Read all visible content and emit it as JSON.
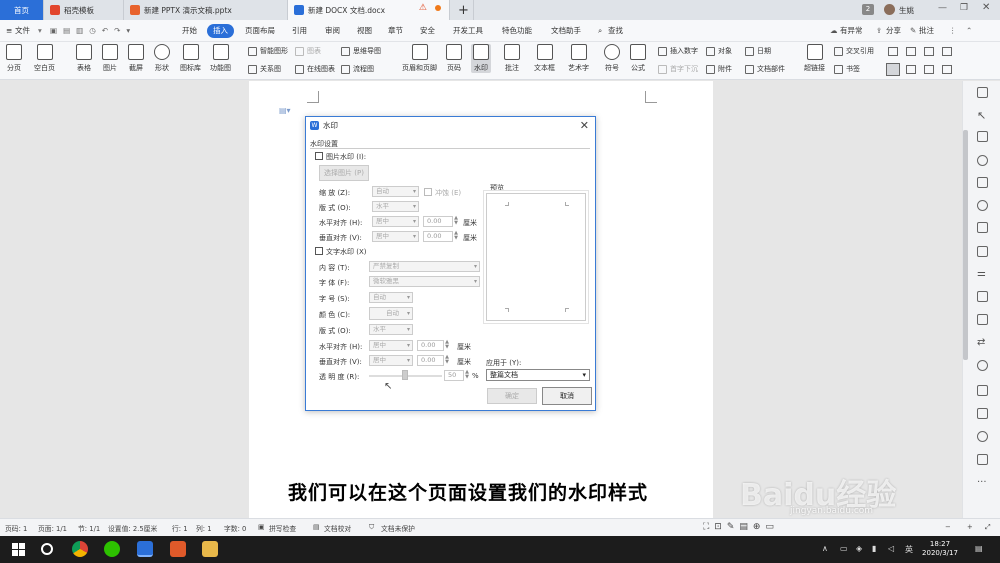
{
  "tabs": [
    {
      "label": "首页"
    },
    {
      "label": "稻壳模板"
    },
    {
      "label": "新建 PPTX 演示文稿.pptx"
    },
    {
      "label": "新建 DOCX 文档.docx"
    }
  ],
  "tab_add": "+",
  "window_controls": {
    "badge": "2",
    "user": "生姚"
  },
  "menu": {
    "file": "文件",
    "items": [
      "开始",
      "插入",
      "页面布局",
      "引用",
      "审阅",
      "视图",
      "章节",
      "安全",
      "开发工具",
      "特色功能",
      "文档助手"
    ],
    "search": "查找",
    "right": [
      "有异常",
      "分享",
      "批注"
    ]
  },
  "ribbon": {
    "big": [
      {
        "label": "分页"
      },
      {
        "label": "空白页"
      },
      {
        "label": "表格"
      },
      {
        "label": "图片"
      },
      {
        "label": "截屏"
      },
      {
        "label": "形状"
      },
      {
        "label": "图标库"
      },
      {
        "label": "功能图"
      },
      {
        "label": "页眉和页脚"
      },
      {
        "label": "页码"
      },
      {
        "label": "水印"
      },
      {
        "label": "批注"
      },
      {
        "label": "文本框"
      },
      {
        "label": "艺术字"
      },
      {
        "label": "符号"
      },
      {
        "label": "公式"
      },
      {
        "label": "超链接"
      }
    ],
    "small": {
      "smart_graphic": "智能图形",
      "chart": "图表",
      "mindmap": "思维导图",
      "relation": "关系图",
      "online_chart": "在线图表",
      "flowchart": "流程图",
      "insert_number": "插入数字",
      "object": "对象",
      "date": "日期",
      "first_sink": "首字下沉",
      "attachment": "附件",
      "doc_parts": "文档部件",
      "cross_ref": "交叉引用",
      "bookmark": "书签"
    }
  },
  "dialog": {
    "title": "水印",
    "section": "水印设置",
    "picture_watermark": "图片水印 (I):",
    "select_picture": "选择图片 (P)",
    "scale_label": "缩    放 (Z):",
    "scale_value": "自动",
    "washout": "冲蚀 (E)",
    "layout_label": "版    式 (O):",
    "layout_value": "水平",
    "h_align_label": "水平对齐 (H):",
    "h_align_value": "居中",
    "h_offset": "0.00",
    "unit": "厘米",
    "v_align_label": "垂直对齐 (V):",
    "v_align_value": "居中",
    "v_offset": "0.00",
    "text_watermark": "文字水印 (X)",
    "content_label": "内    容 (T):",
    "content_value": "严禁复制",
    "font_label": "字    体 (F):",
    "font_value": "微软雅黑",
    "size_label": "字    号 (S):",
    "size_value": "自动",
    "color_label": "颜    色 (C):",
    "color_value": "自动",
    "t_layout_label": "版    式 (O):",
    "t_layout_value": "水平",
    "t_h_align_label": "水平对齐 (H):",
    "t_h_align_value": "居中",
    "t_h_offset": "0.00",
    "t_v_align_label": "垂直对齐 (V):",
    "t_v_align_value": "居中",
    "t_v_offset": "0.00",
    "transparency_label": "透 明 度 (R):",
    "transparency_value": "50",
    "percent": "%",
    "preview": "预览",
    "apply_label": "应用于 (Y):",
    "apply_value": "整篇文档",
    "ok": "确定",
    "cancel": "取消",
    "close": "✕"
  },
  "subtitle": "我们可以在这个页面设置我们的水印样式",
  "watermark": {
    "brand": "Baidu经验",
    "url": "jingyan.baidu.com"
  },
  "status": {
    "page": "页码: 1",
    "pages": "页面: 1/1",
    "section": "节: 1/1",
    "setting": "设置值: 2.5厘米",
    "row": "行: 1",
    "col": "列: 1",
    "words": "字数: 0",
    "spell": "拼写检查",
    "proof": "文档校对",
    "protect": "文档未保护"
  },
  "taskbar": {
    "time": "18:27",
    "date": "2020/3/17",
    "lang": "英"
  }
}
